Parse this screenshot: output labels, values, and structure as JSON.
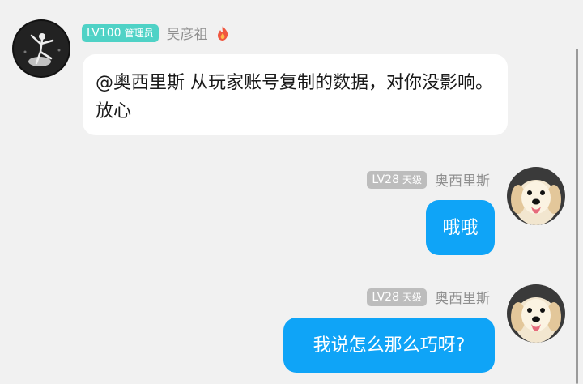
{
  "messages": [
    {
      "side": "left",
      "level": "LV100",
      "role": "管理员",
      "username": "吴彦祖",
      "text": "@奥西里斯 从玩家账号复制的数据，对你没影响。放心",
      "avatar_icon": "dancer-avatar-icon",
      "badge_icon": "fire-icon"
    },
    {
      "side": "right",
      "level": "LV28",
      "role": "天级",
      "username": "奥西里斯",
      "text": "哦哦",
      "avatar_icon": "golden-retriever-avatar-icon"
    },
    {
      "side": "right",
      "level": "LV28",
      "role": "天级",
      "username": "奥西里斯",
      "text": "我说怎么那么巧呀?",
      "avatar_icon": "golden-retriever-avatar-icon"
    }
  ],
  "colors": {
    "background": "#f1f1f1",
    "admin_badge": "#4fd2c6",
    "user_badge": "#bdbdbd",
    "own_bubble": "#0fa4f7",
    "other_bubble": "#ffffff"
  }
}
